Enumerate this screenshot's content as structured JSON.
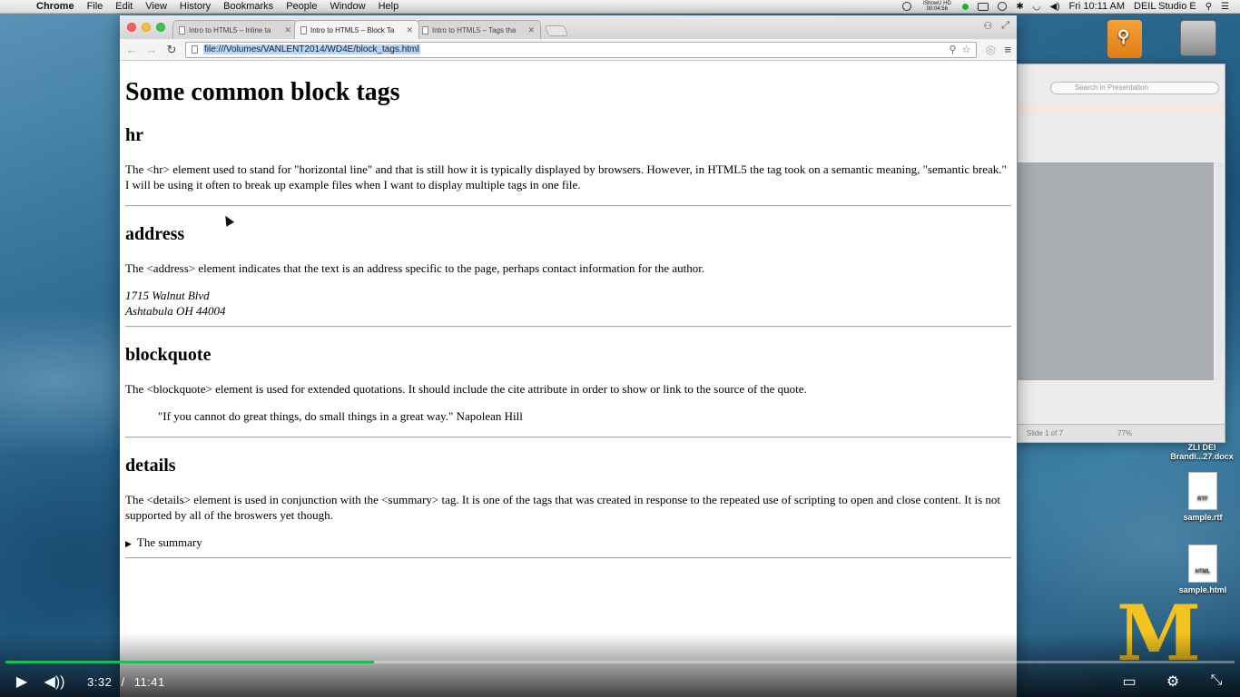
{
  "menubar": {
    "app": "Chrome",
    "items": [
      "File",
      "Edit",
      "View",
      "History",
      "Bookmarks",
      "People",
      "Window",
      "Help"
    ],
    "status_text": "iShowU HD 00:04:56",
    "clock": "Fri 10:11 AM",
    "user": "DEIL Studio E"
  },
  "browser": {
    "tabs": [
      {
        "title": "Intro to HTML5 – Inline ta",
        "active": false
      },
      {
        "title": "Intro to HTML5 – Block Ta",
        "active": true
      },
      {
        "title": "Intro to HTML5 – Tags tha",
        "active": false
      }
    ],
    "url": "file:///Volumes/VANLENT2014/WD4E/block_tags.html"
  },
  "page": {
    "title": "Some common block tags",
    "sections": {
      "hr": {
        "heading": "hr",
        "text": "The <hr> element used to stand for \"horizontal line\" and that is still how it is typically displayed by browsers. However, in HTML5 the tag took on a semantic meaning, \"semantic break.\" I will be using it often to break up example files when I want to display multiple tags in one file."
      },
      "address": {
        "heading": "address",
        "text": "The <address> element indicates that the text is an address specific to the page, perhaps contact information for the author.",
        "line1": "1715 Walnut Blvd",
        "line2": "Ashtabula OH 44004"
      },
      "blockquote": {
        "heading": "blockquote",
        "text": "The <blockquote> element is used for extended quotations. It should include the cite attribute in order to show or link to the source of the quote.",
        "quote": "\"If you cannot do great things, do small things in a great way.\" Napolean Hill"
      },
      "details": {
        "heading": "details",
        "text": "The <details> element is used in conjunction with the <summary> tag. It is one of the tags that was created in response to the repeated use of scripting to open and close content. It is not supported by all of the broswers yet though.",
        "summary": "The summary"
      }
    }
  },
  "presentation": {
    "search_placeholder": "Search in Presentation",
    "slide_status": "Slide 1 of 7",
    "zoom": "77%"
  },
  "desktop": {
    "icons": [
      "ZLI DEI Brandi...27.docx",
      "sample.rtf",
      "sample.html"
    ],
    "file_badges": {
      "rtf": "RTF",
      "html": "HTML"
    },
    "logo": "M"
  },
  "player": {
    "current_time": "3:32",
    "separator": "/",
    "duration": "11:41",
    "progress": 0.3,
    "accent_color": "#1dba5a"
  }
}
